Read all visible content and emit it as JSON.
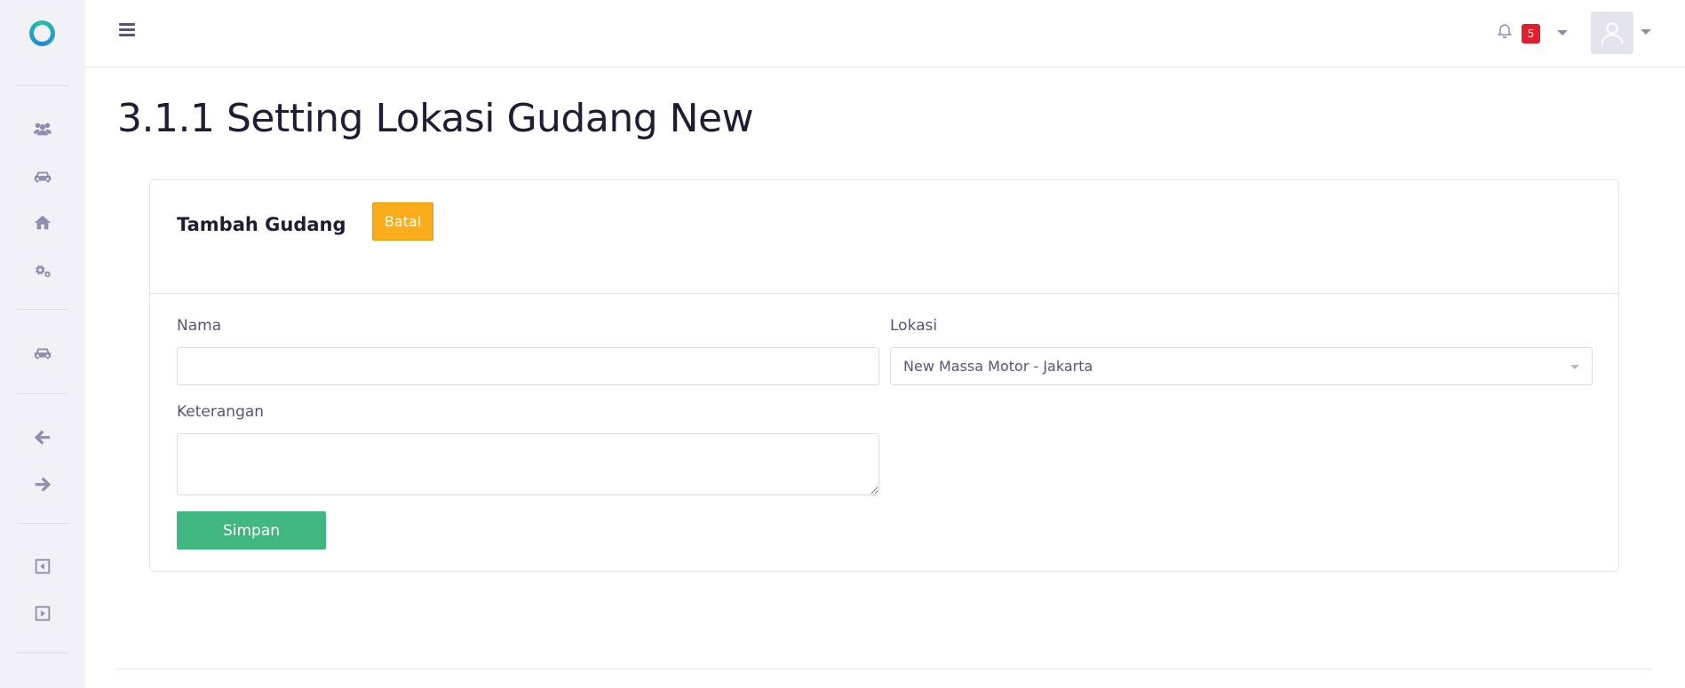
{
  "page": {
    "title": "3.1.1 Setting Lokasi Gudang New"
  },
  "topbar": {
    "notification_count": "5"
  },
  "sidebar": {
    "icons": [
      "users-icon",
      "car-icon",
      "home-icon",
      "gears-icon",
      "car-icon",
      "arrow-left-icon",
      "arrow-right-icon",
      "collapse-left-icon",
      "expand-right-icon"
    ]
  },
  "form": {
    "header_title": "Tambah Gudang",
    "cancel_label": "Batal",
    "nama_label": "Nama",
    "nama_value": "",
    "lokasi_label": "Lokasi",
    "lokasi_value": "New Massa Motor - Jakarta",
    "keterangan_label": "Keterangan",
    "keterangan_value": "",
    "submit_label": "Simpan"
  },
  "colors": {
    "cancel_button": "#fbad19",
    "submit_button": "#40b77f",
    "notification_badge": "#e0202f"
  }
}
